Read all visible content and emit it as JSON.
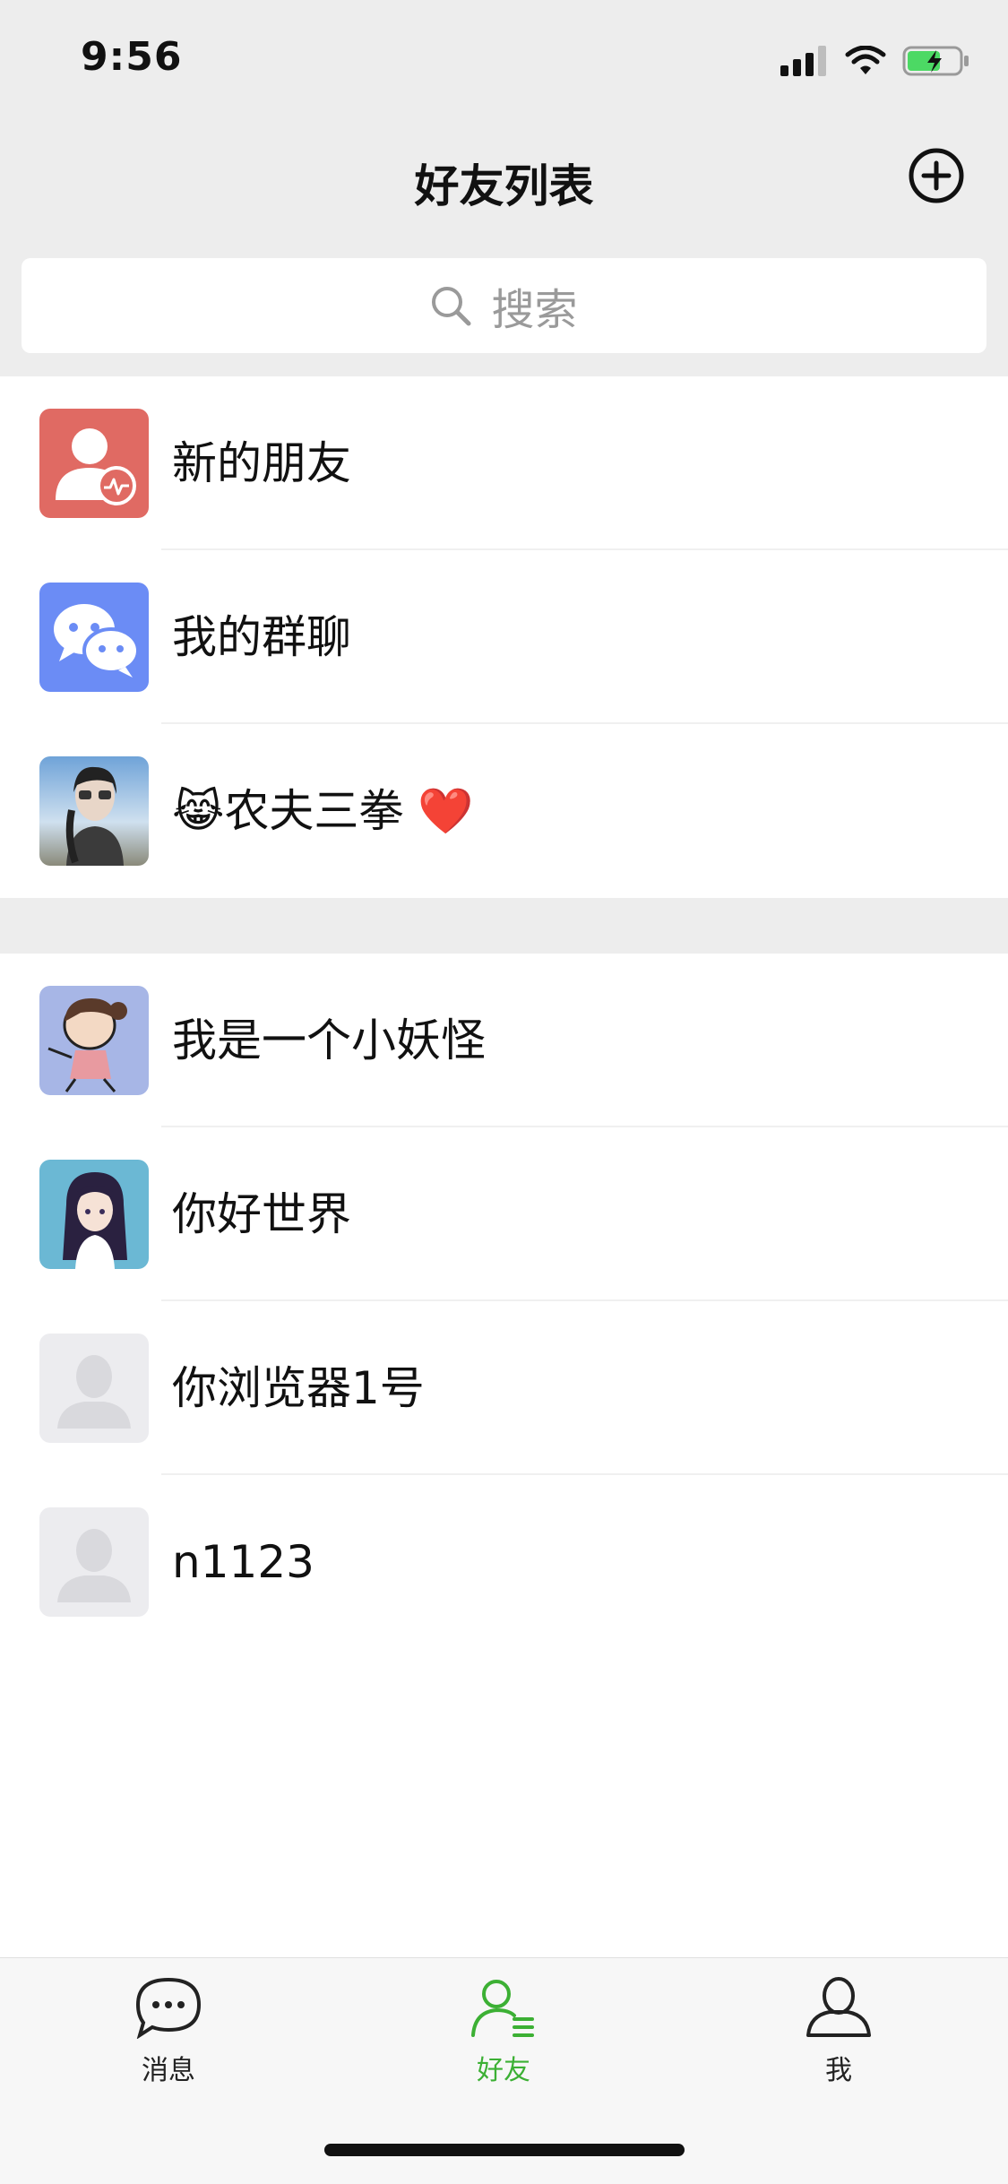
{
  "status_bar": {
    "time": "9:56"
  },
  "nav": {
    "title": "好友列表"
  },
  "search": {
    "placeholder": "搜索"
  },
  "group1": [
    {
      "name": "新的朋友",
      "avatar": "new-friend-icon"
    },
    {
      "name": "我的群聊",
      "avatar": "group-chat-icon"
    },
    {
      "name": "农夫三拳",
      "prefix_emoji": "😹",
      "suffix_emoji": "❤️",
      "avatar": "photo-avatar"
    }
  ],
  "group2": [
    {
      "name": "我是一个小妖怪",
      "avatar": "cartoon-avatar"
    },
    {
      "name": "你好世界",
      "avatar": "anime-avatar"
    },
    {
      "name": "你浏览器1号",
      "avatar": "default-avatar"
    },
    {
      "name": "n1123",
      "avatar": "default-avatar"
    }
  ],
  "tabs": [
    {
      "label": "消息",
      "icon": "chat-bubble-icon",
      "active": false
    },
    {
      "label": "好友",
      "icon": "contacts-icon",
      "active": true
    },
    {
      "label": "我",
      "icon": "person-icon",
      "active": false
    }
  ],
  "colors": {
    "active_tab": "#3cb034",
    "background": "#ededed",
    "new_friend": "#e06a63",
    "group_chat": "#6b8cf5"
  }
}
